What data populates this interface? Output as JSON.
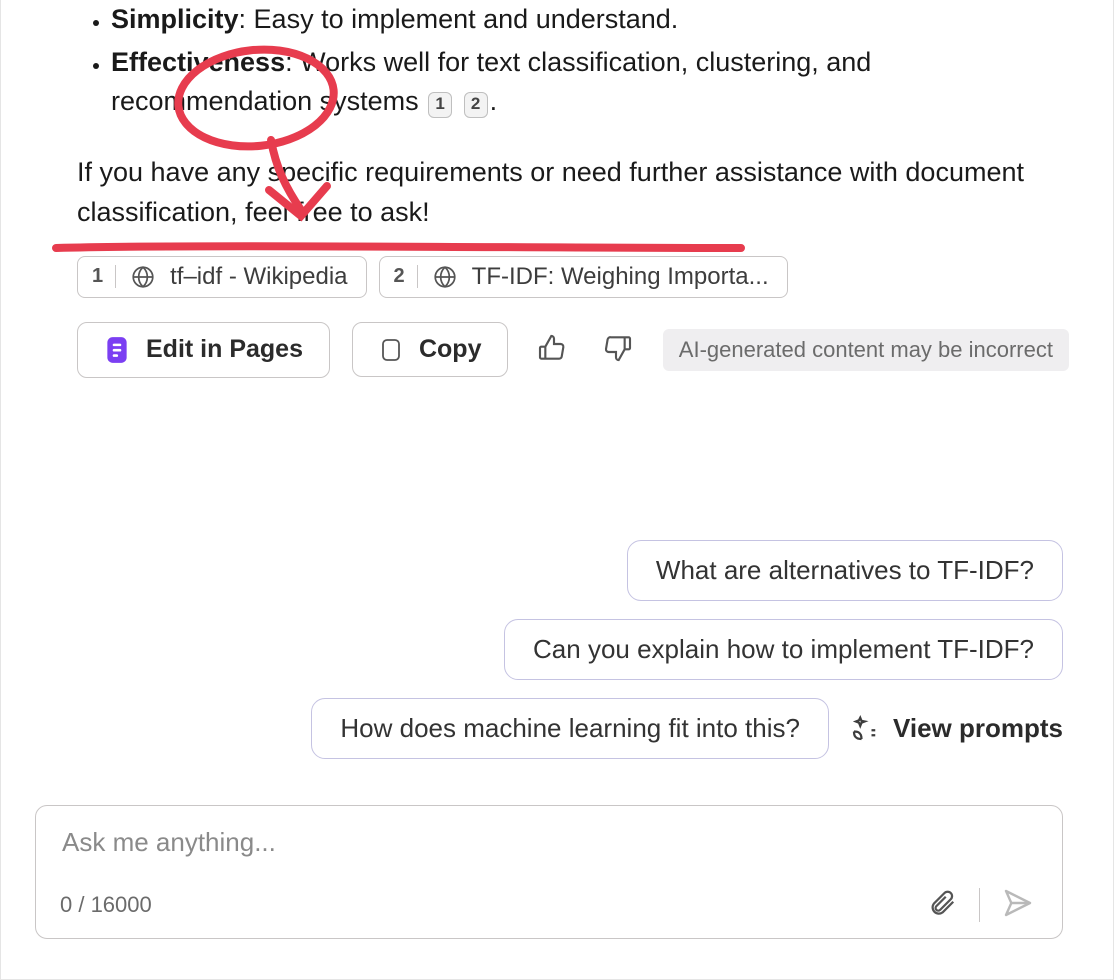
{
  "message": {
    "bullets": [
      {
        "title": "Simplicity",
        "body": ": Easy to implement and understand."
      },
      {
        "title": "Effectiveness",
        "body": ": Works well for text classification, clustering, and recommendation systems",
        "citations": [
          "1",
          "2"
        ],
        "trailing": "."
      }
    ],
    "closing": "If you have any specific requirements or need further assistance with document classification, feel free to ask!"
  },
  "sources": [
    {
      "num": "1",
      "label": "tf–idf - Wikipedia"
    },
    {
      "num": "2",
      "label": "TF-IDF: Weighing Importa..."
    }
  ],
  "actions": {
    "edit": "Edit in Pages",
    "copy": "Copy",
    "disclaimer": "AI-generated content may be incorrect"
  },
  "suggestions": [
    "What are alternatives to TF-IDF?",
    "Can you explain how to implement TF-IDF?",
    "How does machine learning fit into this?"
  ],
  "view_prompts_label": "View prompts",
  "input": {
    "placeholder": "Ask me anything...",
    "char_count": "0 / 16000"
  },
  "colors": {
    "accent_purple": "#7b3ff2",
    "ink_red": "#e73c4e",
    "chip_border": "#c5c3e2"
  }
}
